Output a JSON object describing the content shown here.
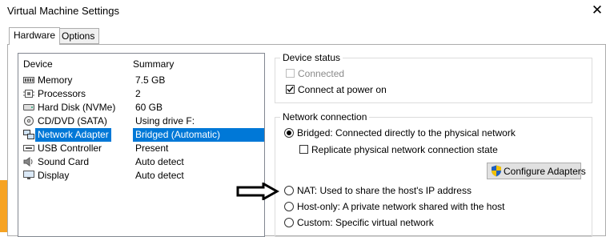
{
  "window": {
    "title": "Virtual Machine Settings",
    "close_glyph": "✕"
  },
  "tabs": [
    {
      "label": "Hardware",
      "active": true
    },
    {
      "label": "Options",
      "active": false
    }
  ],
  "device_list": {
    "col_device": "Device",
    "col_summary": "Summary",
    "items": [
      {
        "name": "Memory",
        "summary": "7.5 GB",
        "icon": "memory-icon"
      },
      {
        "name": "Processors",
        "summary": "2",
        "icon": "processor-icon"
      },
      {
        "name": "Hard Disk (NVMe)",
        "summary": "60 GB",
        "icon": "hard-disk-icon"
      },
      {
        "name": "CD/DVD (SATA)",
        "summary": "Using drive F:",
        "icon": "cd-dvd-icon"
      },
      {
        "name": "Network Adapter",
        "summary": "Bridged (Automatic)",
        "icon": "network-adapter-icon",
        "selected": true
      },
      {
        "name": "USB Controller",
        "summary": "Present",
        "icon": "usb-icon"
      },
      {
        "name": "Sound Card",
        "summary": "Auto detect",
        "icon": "sound-card-icon"
      },
      {
        "name": "Display",
        "summary": "Auto detect",
        "icon": "display-icon"
      }
    ]
  },
  "device_status": {
    "title": "Device status",
    "connected": {
      "label": "Connected",
      "checked": false,
      "disabled": true
    },
    "connect_at_power_on": {
      "label": "Connect at power on",
      "checked": true
    }
  },
  "network_connection": {
    "title": "Network connection",
    "bridged": {
      "label": "Bridged: Connected directly to the physical network",
      "selected": true
    },
    "replicate": {
      "label": "Replicate physical network connection state",
      "checked": false
    },
    "configure_adapters": "Configure Adapters",
    "nat": {
      "label": "NAT: Used to share the host's IP address",
      "selected": false
    },
    "host_only": {
      "label": "Host-only: A private network shared with the host",
      "selected": false
    },
    "custom": {
      "label": "Custom: Specific virtual network",
      "selected": false
    }
  },
  "colors": {
    "selection": "#0078d7",
    "orange_strip": "#f6a323"
  }
}
